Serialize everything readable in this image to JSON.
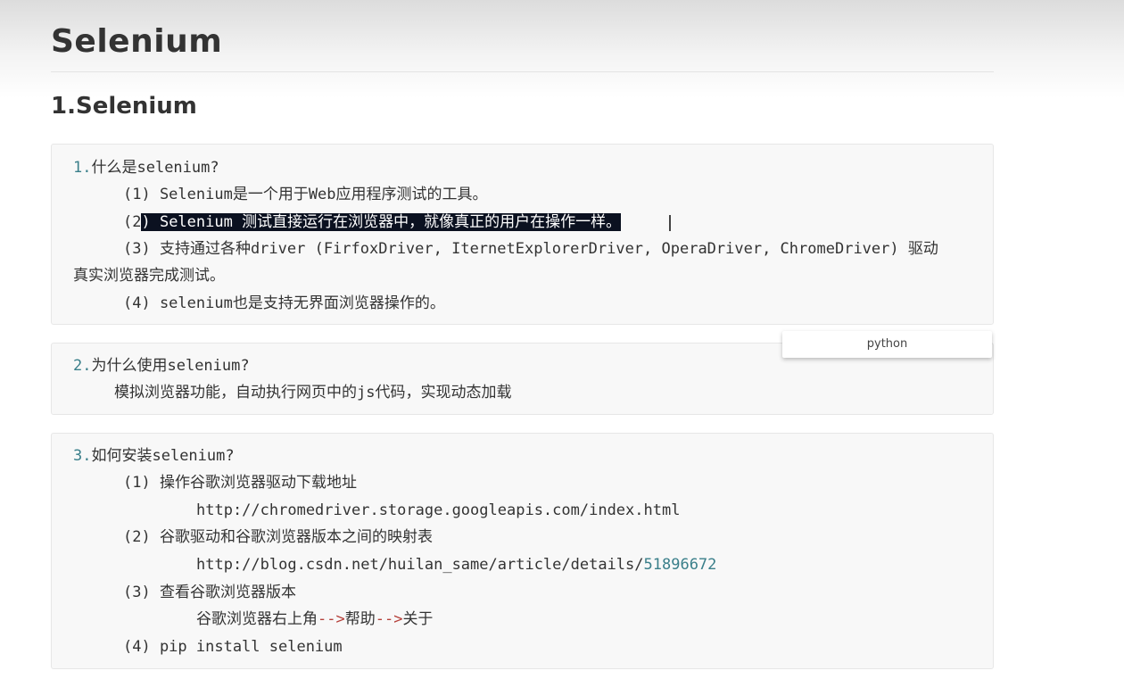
{
  "title": "Selenium",
  "section_heading": "1.Selenium",
  "blocks": {
    "b1": {
      "num": "1.",
      "heading": "什么是selenium?",
      "l1": "(1) Selenium是一个用于Web应用程序测试的工具。",
      "l2_pre": "(2",
      "l2_sel": ") Selenium 测试直接运行在浏览器中，就像真正的用户在操作一样。",
      "l3": "(3) 支持通过各种driver (FirfoxDriver, IternetExplorerDriver, OperaDriver, ChromeDriver) 驱动",
      "l3b": "真实浏览器完成测试。",
      "l4": "(4) selenium也是支持无界面浏览器操作的。"
    },
    "b2": {
      "num": "2.",
      "heading": "为什么使用selenium?",
      "l1": "模拟浏览器功能，自动执行网页中的js代码，实现动态加载"
    },
    "b3": {
      "num": "3.",
      "heading": "如何安装selenium?",
      "l1": "(1) 操作谷歌浏览器驱动下载地址",
      "l1_url": "http://chromedriver.storage.googleapis.com/index.html",
      "l2": "(2) 谷歌驱动和谷歌浏览器版本之间的映射表",
      "l2_url_pre": "http://blog.csdn.net/huilan_same/article/details/",
      "l2_url_num": "51896672",
      "l3": "(3) 查看谷歌浏览器版本",
      "l3_a": "谷歌浏览器右上角",
      "l3_arrow1": "-->",
      "l3_b": "帮助",
      "l3_arrow2": "-->",
      "l3_c": "关于",
      "l4": "(4) pip install selenium"
    }
  },
  "lang_tag": "python",
  "colors": {
    "number": "#3a7f8a",
    "arrow": "#b5403a",
    "selection": "#0b1120"
  }
}
